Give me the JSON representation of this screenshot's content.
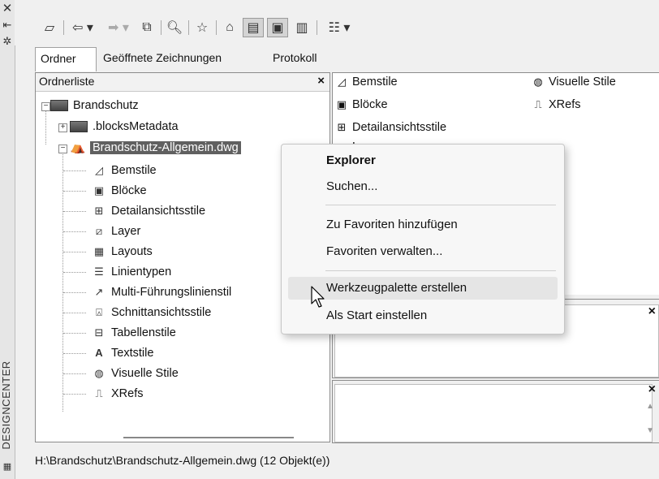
{
  "window": {
    "side_title": "DESIGNCENTER"
  },
  "tabs": [
    {
      "label": "Ordner"
    },
    {
      "label": "Geöffnete Zeichnungen"
    },
    {
      "label": "Protokoll"
    }
  ],
  "folder_panel": {
    "title": "Ordnerliste",
    "close_glyph": "×",
    "tree": {
      "root": "Brandschutz",
      "metadata": ".blocksMetadata",
      "drawing": "Brandschutz-Allgemein.dwg",
      "children": [
        "Bemstile",
        "Blöcke",
        "Detailansichtsstile",
        "Layer",
        "Layouts",
        "Linientypen",
        "Multi-Führungslinienstil",
        "Schnittansichtsstile",
        "Tabellenstile",
        "Textstile",
        "Visuelle Stile",
        "XRefs"
      ]
    }
  },
  "content_pane": {
    "items_col1": [
      "Bemstile",
      "Blöcke",
      "Detailansichtsstile",
      "Layer"
    ],
    "items_col2": [
      "Visuelle Stile",
      "XRefs"
    ]
  },
  "preview_close_glyph": "×",
  "context_menu": {
    "items": [
      {
        "label": "Explorer"
      },
      {
        "label": "Suchen..."
      },
      {
        "label": "Zu Favoriten hinzufügen"
      },
      {
        "label": "Favoriten verwalten..."
      },
      {
        "label": "Werkzeugpalette erstellen"
      },
      {
        "label": "Als Start einstellen"
      }
    ]
  },
  "status_bar": {
    "text": "H:\\Brandschutz\\Brandschutz-Allgemein.dwg (12 Objekt(e))"
  }
}
